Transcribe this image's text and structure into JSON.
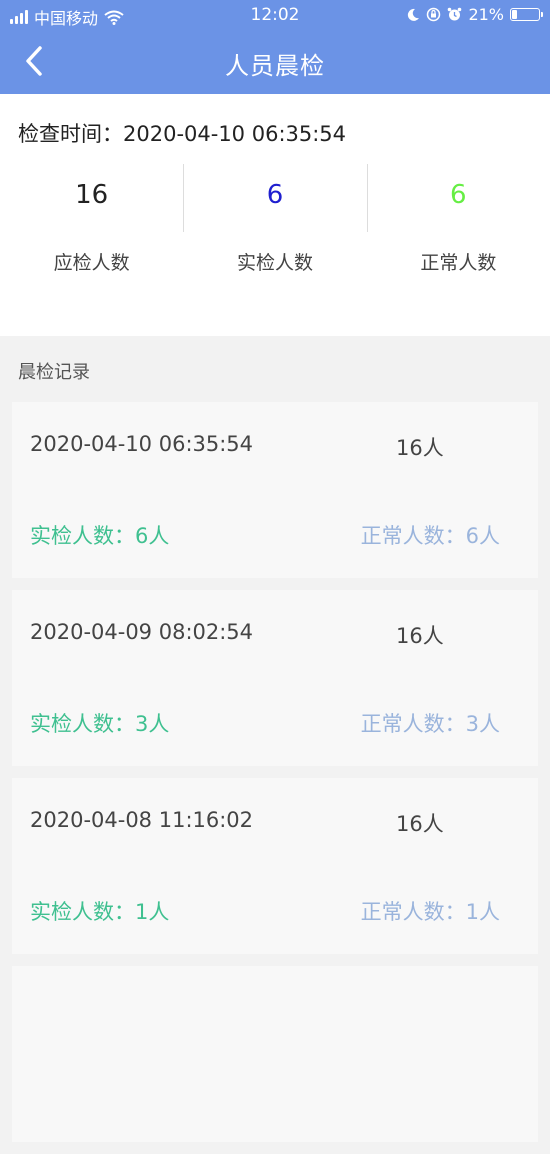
{
  "status_bar": {
    "carrier": "中国移动",
    "time": "12:02",
    "battery": "21%",
    "battery_level": 0.21
  },
  "nav": {
    "title": "人员晨检",
    "back_icon": "chevron-left-icon"
  },
  "summary": {
    "check_time_label": "检查时间：",
    "check_time": "2020-04-10 06:35:54",
    "stats": [
      {
        "value": "16",
        "label": "应检人数",
        "color": "#222222"
      },
      {
        "value": "6",
        "label": "实检人数",
        "color": "#1f1fcf"
      },
      {
        "value": "6",
        "label": "正常人数",
        "color": "#66ee44"
      }
    ]
  },
  "records_title": "晨检记录",
  "records": [
    {
      "datetime": "2020-04-10 06:35:54",
      "total": "16人",
      "actual": "实检人数：6人",
      "normal": "正常人数：6人"
    },
    {
      "datetime": "2020-04-09 08:02:54",
      "total": "16人",
      "actual": "实检人数：3人",
      "normal": "正常人数：3人"
    },
    {
      "datetime": "2020-04-08 11:16:02",
      "total": "16人",
      "actual": "实检人数：1人",
      "normal": "正常人数：1人"
    }
  ],
  "colors": {
    "header": "#6b93e6",
    "actual_text": "#3fc090",
    "normal_text": "#9ab4dc"
  }
}
